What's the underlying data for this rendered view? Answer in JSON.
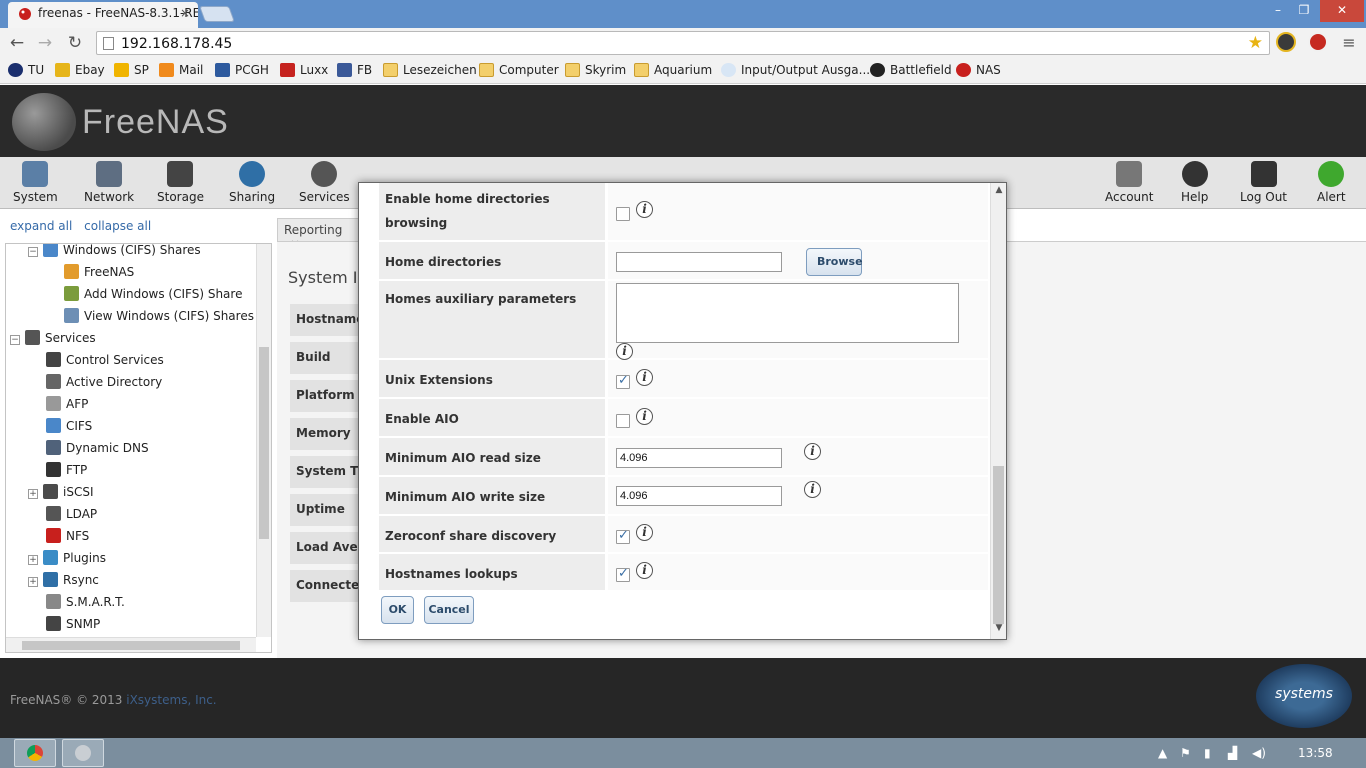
{
  "browser": {
    "tab_title": "freenas - FreeNAS-8.3.1-RE",
    "tab_close": "×",
    "url": "192.168.178.45",
    "window_controls": {
      "minimize": "–",
      "maximize": "❐",
      "close": "✕"
    }
  },
  "bookmarks": [
    {
      "label": "TU",
      "icon": "tu-icon"
    },
    {
      "label": "Ebay",
      "icon": "ebay-icon"
    },
    {
      "label": "SP",
      "icon": "sp-icon"
    },
    {
      "label": "Mail",
      "icon": "mail-icon"
    },
    {
      "label": "PCGH",
      "icon": "pcgh-icon"
    },
    {
      "label": "Luxx",
      "icon": "luxx-icon"
    },
    {
      "label": "FB",
      "icon": "facebook-icon"
    },
    {
      "label": "Lesezeichen",
      "icon": "folder-icon"
    },
    {
      "label": "Computer",
      "icon": "folder-icon"
    },
    {
      "label": "Skyrim",
      "icon": "folder-icon"
    },
    {
      "label": "Aquarium",
      "icon": "folder-icon"
    },
    {
      "label": "Input/Output Ausga...",
      "icon": "gear-icon"
    },
    {
      "label": "Battlefield",
      "icon": "ea-icon"
    },
    {
      "label": "NAS",
      "icon": "freenas-icon"
    }
  ],
  "app": {
    "logo_text": "FreeNAS"
  },
  "nav": {
    "left": [
      {
        "label": "System",
        "icon": "system-icon"
      },
      {
        "label": "Network",
        "icon": "network-icon"
      },
      {
        "label": "Storage",
        "icon": "storage-icon"
      },
      {
        "label": "Sharing",
        "icon": "sharing-icon"
      },
      {
        "label": "Services",
        "icon": "services-icon"
      }
    ],
    "right": [
      {
        "label": "Account",
        "icon": "account-icon"
      },
      {
        "label": "Help",
        "icon": "help-icon"
      },
      {
        "label": "Log Out",
        "icon": "logout-icon"
      },
      {
        "label": "Alert",
        "icon": "alert-icon"
      }
    ]
  },
  "tree": {
    "expand_all": "expand all",
    "collapse_all": "collapse all",
    "items": [
      {
        "label": "Windows (CIFS) Shares",
        "indent": 2,
        "icon": "cifs-icon",
        "expander": "−"
      },
      {
        "label": "FreeNAS",
        "indent": 3,
        "icon": "cifs-share-icon",
        "expander": ""
      },
      {
        "label": "Add Windows (CIFS) Share",
        "indent": 3,
        "icon": "add-share-icon",
        "expander": ""
      },
      {
        "label": "View Windows (CIFS) Shares",
        "indent": 3,
        "icon": "view-shares-icon",
        "expander": ""
      },
      {
        "label": "Services",
        "indent": 0,
        "icon": "services-icon",
        "expander": "−"
      },
      {
        "label": "Control Services",
        "indent": 1,
        "icon": "control-services-icon",
        "expander": ""
      },
      {
        "label": "Active Directory",
        "indent": 1,
        "icon": "active-directory-icon",
        "expander": ""
      },
      {
        "label": "AFP",
        "indent": 1,
        "icon": "afp-icon",
        "expander": ""
      },
      {
        "label": "CIFS",
        "indent": 1,
        "icon": "cifs-icon",
        "expander": ""
      },
      {
        "label": "Dynamic DNS",
        "indent": 1,
        "icon": "dynamic-dns-icon",
        "expander": ""
      },
      {
        "label": "FTP",
        "indent": 1,
        "icon": "ftp-icon",
        "expander": ""
      },
      {
        "label": "iSCSI",
        "indent": 1,
        "icon": "iscsi-icon",
        "expander": "+"
      },
      {
        "label": "LDAP",
        "indent": 1,
        "icon": "ldap-icon",
        "expander": ""
      },
      {
        "label": "NFS",
        "indent": 1,
        "icon": "nfs-icon",
        "expander": ""
      },
      {
        "label": "Plugins",
        "indent": 1,
        "icon": "plugins-icon",
        "expander": "+"
      },
      {
        "label": "Rsync",
        "indent": 1,
        "icon": "rsync-icon",
        "expander": "+"
      },
      {
        "label": "S.M.A.R.T.",
        "indent": 1,
        "icon": "smart-icon",
        "expander": ""
      },
      {
        "label": "SNMP",
        "indent": 1,
        "icon": "snmp-icon",
        "expander": ""
      }
    ]
  },
  "content": {
    "tab_label": "Reporting",
    "tab_close": "×",
    "sysinfo_title": "System In",
    "sysinfo_rows": [
      "Hostname",
      "Build",
      "Platform",
      "Memory",
      "System T",
      "Uptime",
      "Load Ave",
      "Connecte"
    ]
  },
  "dialog": {
    "rows": [
      {
        "label": "Enable home directories browsing",
        "type": "checkbox",
        "checked": false
      },
      {
        "label": "Home directories",
        "type": "text",
        "value": "",
        "button": "Browse"
      },
      {
        "label": "Homes auxiliary parameters",
        "type": "textarea",
        "value": ""
      },
      {
        "label": "Unix Extensions",
        "type": "checkbox",
        "checked": true
      },
      {
        "label": "Enable AIO",
        "type": "checkbox",
        "checked": false
      },
      {
        "label": "Minimum AIO read size",
        "type": "text",
        "value": "4.096"
      },
      {
        "label": "Minimum AIO write size",
        "type": "text",
        "value": "4.096"
      },
      {
        "label": "Zeroconf share discovery",
        "type": "checkbox",
        "checked": true
      },
      {
        "label": "Hostnames lookups",
        "type": "checkbox",
        "checked": true
      }
    ],
    "info_glyph": "i",
    "ok_label": "OK",
    "cancel_label": "Cancel"
  },
  "footer": {
    "copyright": "FreeNAS® © 2013 ",
    "company_link": "iXsystems, Inc.",
    "logo_text": "systems"
  },
  "taskbar": {
    "clock": "13:58"
  },
  "colors": {
    "header_bg": "#2a2a2a",
    "nav_bg": "#e4e4e4",
    "link": "#356aa8",
    "checkbox_check": "#3b6fa5"
  }
}
